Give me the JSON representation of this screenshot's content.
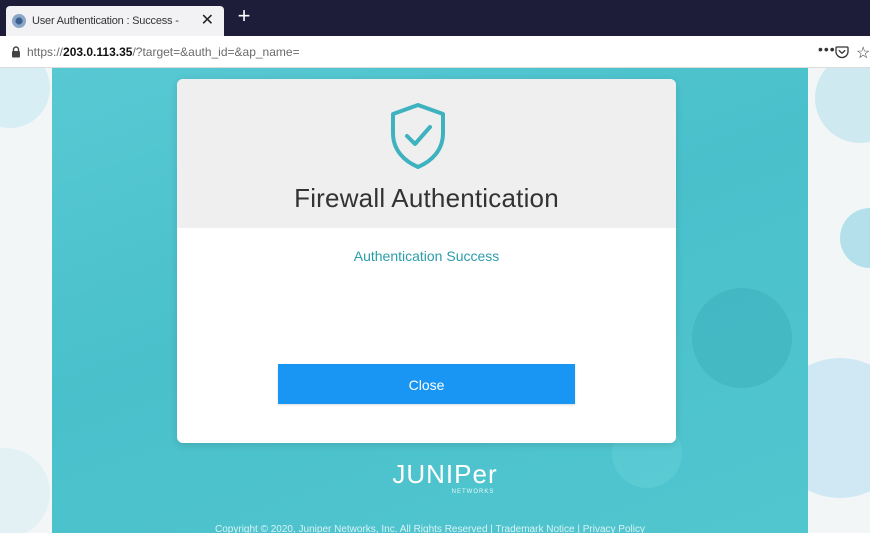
{
  "browser": {
    "tab_title": "User Authentication : Success -",
    "tab_close": "✕",
    "new_tab": "+",
    "url_prefix": "https://",
    "url_host": "203.0.113.35",
    "url_path": "/?target=&auth_id=&ap_name=",
    "more": "•••",
    "star": "☆"
  },
  "dialog": {
    "title": "Firewall Authentication",
    "status": "Authentication Success",
    "close_label": "Close"
  },
  "brand": {
    "logo_text": "JUNIPer",
    "logo_sub": "NETWORKS"
  },
  "footer": {
    "text": "Copyright © 2020, Juniper Networks, Inc. All Rights Reserved | Trademark Notice | Privacy Policy"
  },
  "colors": {
    "teal": "#49c0cb",
    "button": "#1996f3",
    "status": "#2a9dab"
  }
}
